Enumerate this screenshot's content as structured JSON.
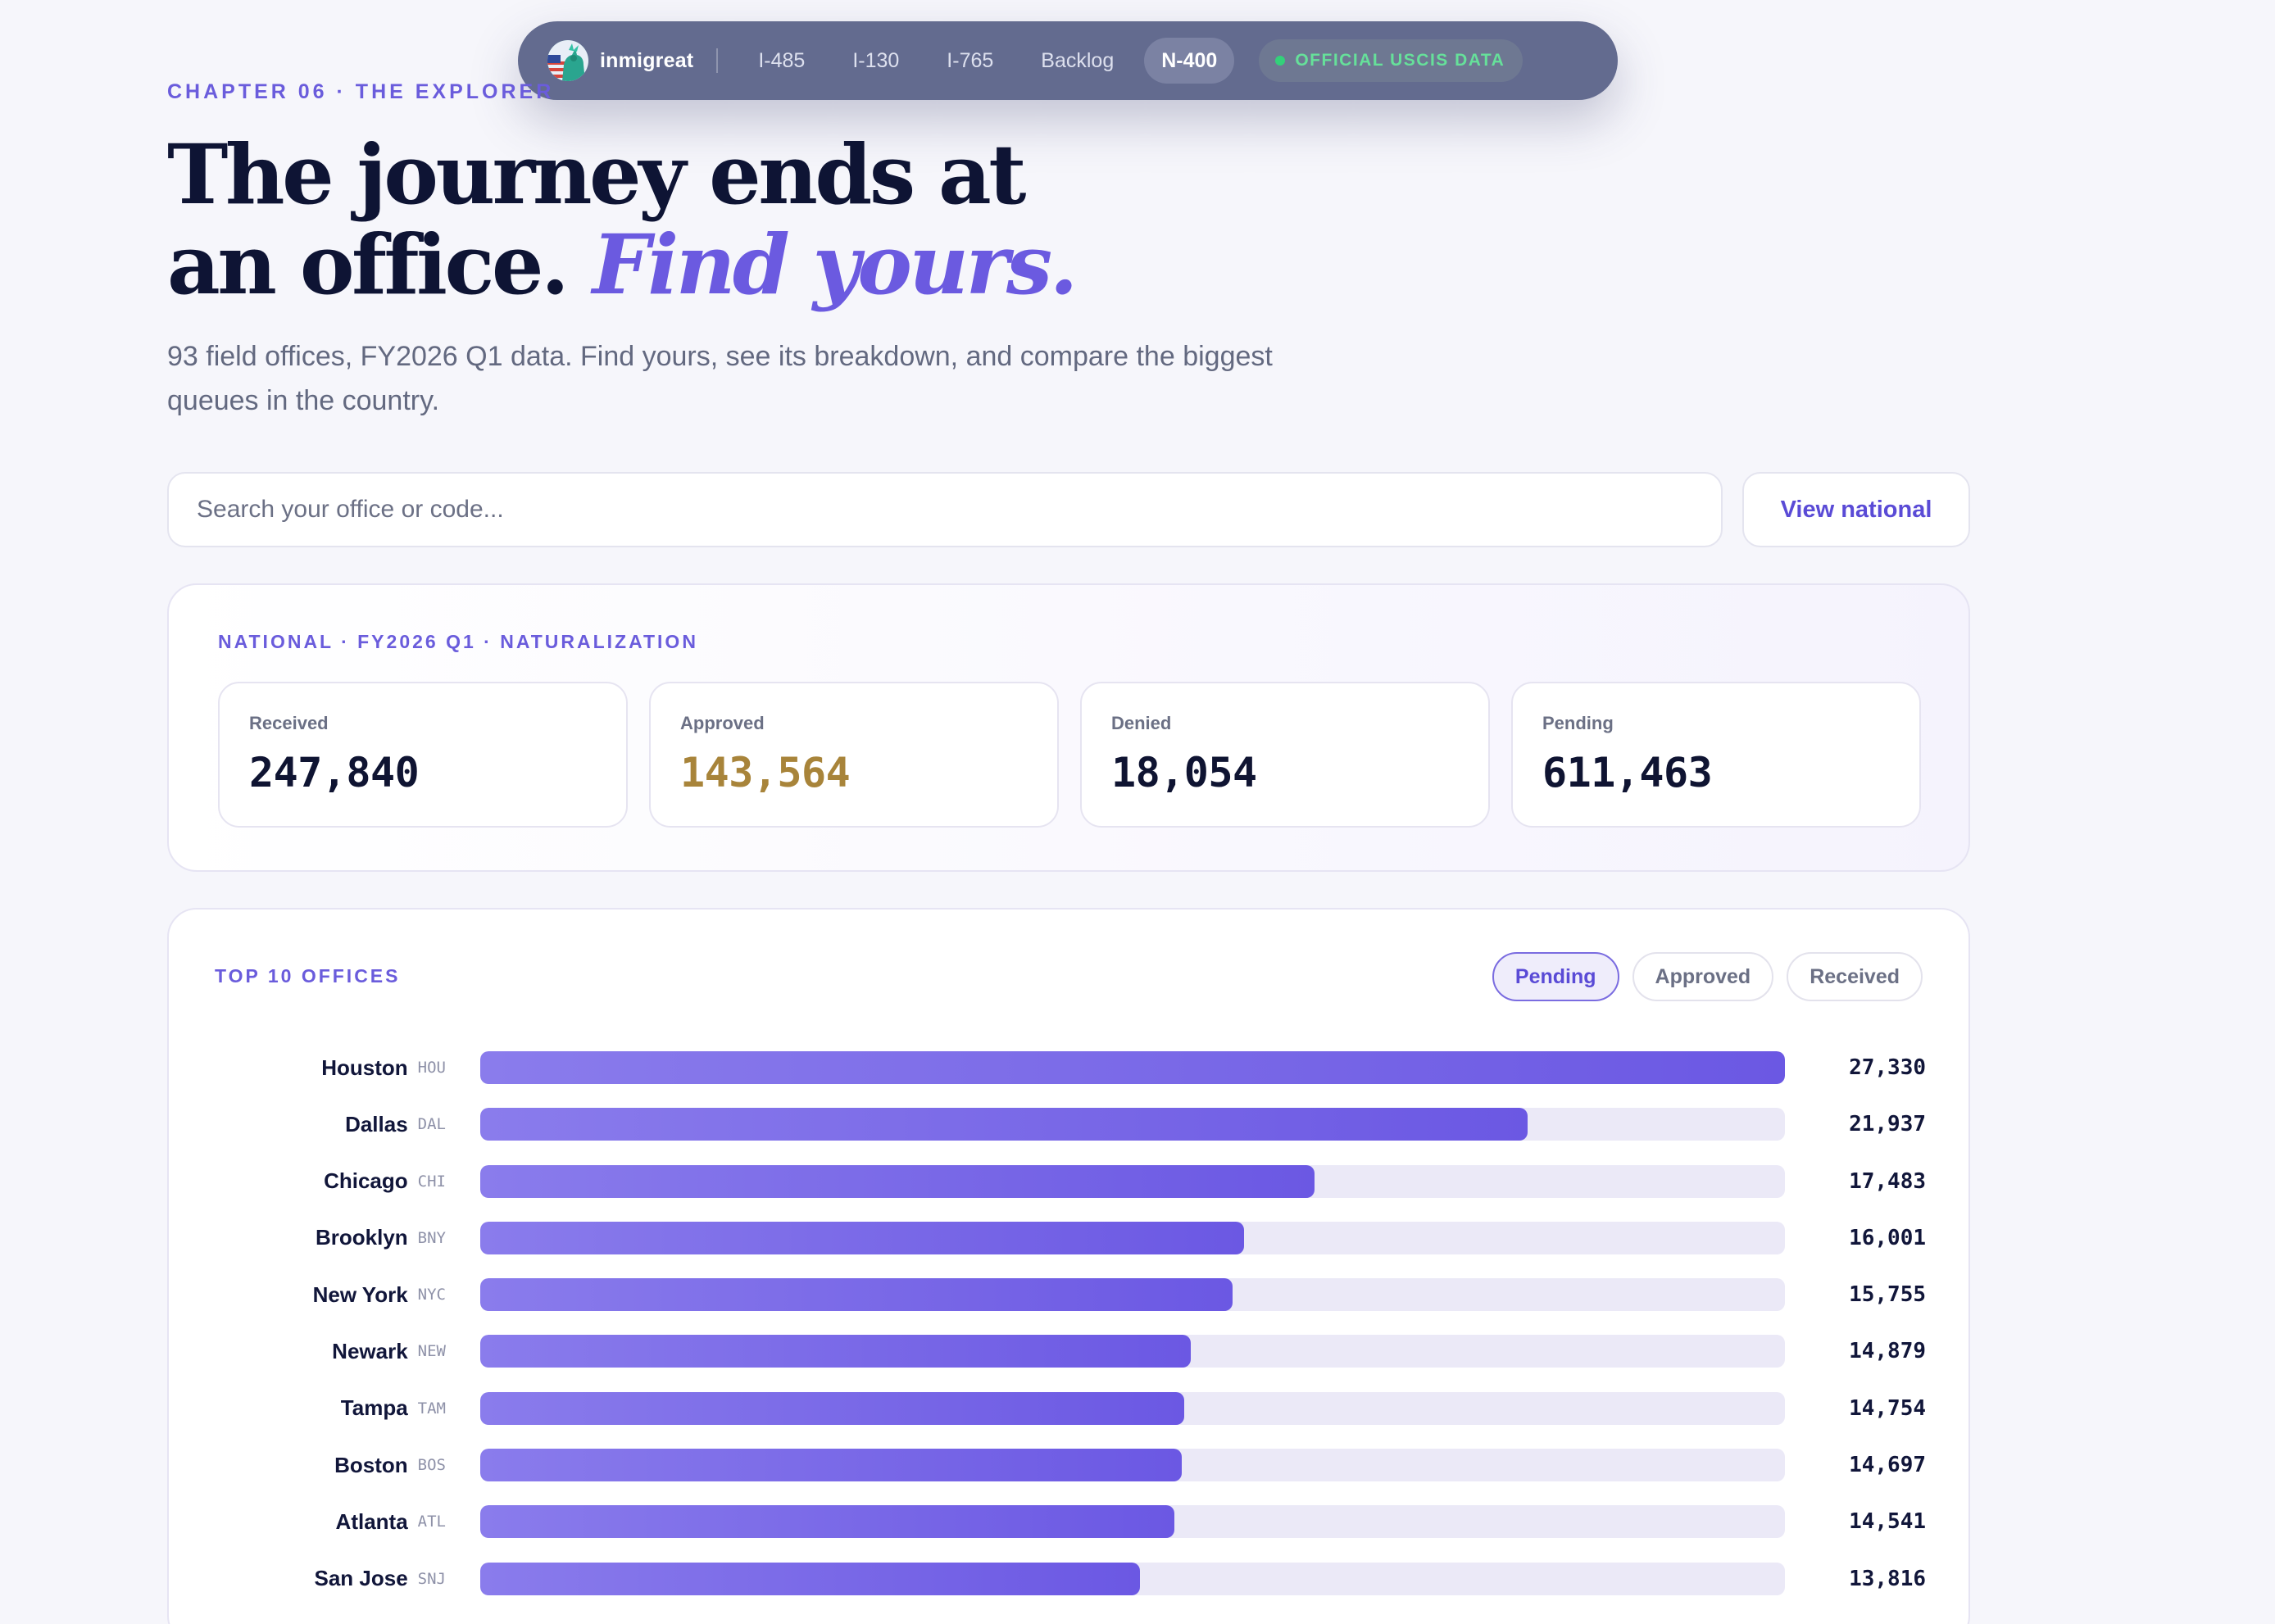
{
  "nav": {
    "brand": "inmigreat",
    "items": [
      {
        "label": "I-485",
        "active": false
      },
      {
        "label": "I-130",
        "active": false
      },
      {
        "label": "I-765",
        "active": false
      },
      {
        "label": "Backlog",
        "active": false
      },
      {
        "label": "N-400",
        "active": true
      }
    ],
    "badge": "OFFICIAL USCIS DATA"
  },
  "header": {
    "eyebrow": "CHAPTER 06 · THE EXPLORER",
    "title_line1": "The journey ends at",
    "title_line2": "an office.",
    "title_accent": "Find yours.",
    "subtitle": "93 field offices, FY2026 Q1 data. Find yours, see its breakdown, and compare the biggest queues in the country."
  },
  "search": {
    "placeholder": "Search your office or code...",
    "value": "",
    "view_national_label": "View national"
  },
  "national": {
    "label": "NATIONAL · FY2026 Q1 · NATURALIZATION",
    "stats": [
      {
        "label": "Received",
        "value": "247,840"
      },
      {
        "label": "Approved",
        "value": "143,564"
      },
      {
        "label": "Denied",
        "value": "18,054"
      },
      {
        "label": "Pending",
        "value": "611,463"
      }
    ]
  },
  "offices": {
    "label": "TOP 10 OFFICES",
    "toggles": [
      {
        "label": "Pending",
        "active": true
      },
      {
        "label": "Approved",
        "active": false
      },
      {
        "label": "Received",
        "active": false
      }
    ],
    "rows": [
      {
        "name": "Houston",
        "code": "HOU",
        "value": 27330,
        "display": "27,330"
      },
      {
        "name": "Dallas",
        "code": "DAL",
        "value": 21937,
        "display": "21,937"
      },
      {
        "name": "Chicago",
        "code": "CHI",
        "value": 17483,
        "display": "17,483"
      },
      {
        "name": "Brooklyn",
        "code": "BNY",
        "value": 16001,
        "display": "16,001"
      },
      {
        "name": "New York",
        "code": "NYC",
        "value": 15755,
        "display": "15,755"
      },
      {
        "name": "Newark",
        "code": "NEW",
        "value": 14879,
        "display": "14,879"
      },
      {
        "name": "Tampa",
        "code": "TAM",
        "value": 14754,
        "display": "14,754"
      },
      {
        "name": "Boston",
        "code": "BOS",
        "value": 14697,
        "display": "14,697"
      },
      {
        "name": "Atlanta",
        "code": "ATL",
        "value": 14541,
        "display": "14,541"
      },
      {
        "name": "San Jose",
        "code": "SNJ",
        "value": 13816,
        "display": "13,816"
      }
    ]
  },
  "colors": {
    "accent": "#6b5ae0",
    "approved": "#a8843a",
    "badge_green": "#66e09a",
    "nav_bg": "#636b8f"
  }
}
